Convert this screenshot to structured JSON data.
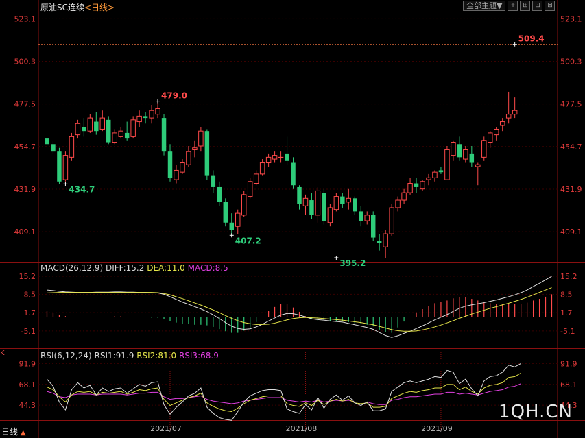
{
  "header": {
    "title": "原油SC连续",
    "period": "<日线>"
  },
  "toolbar": {
    "theme_label": "全部主题▼",
    "buttons": [
      "+",
      "⊞",
      "⊡",
      "⊠"
    ]
  },
  "macd_header": {
    "params": "MACD(26,12,9)",
    "diff": "DIFF:15.2",
    "dea": "DEA:11.0",
    "macd": "MACD:8.5"
  },
  "rsi_header": {
    "params": "RSI(6,12,24)",
    "rsi1": "RSI1:91.9",
    "rsi2": "RSI2:81.0",
    "rsi3": "RSI3:68.9"
  },
  "watermark": "1QH.CN",
  "period_button": {
    "label": "日线",
    "arrow": "▲"
  },
  "side_mark": "K",
  "colors": {
    "up": "#ff4a4a",
    "down": "#2ecc7a",
    "axis": "#e03a3a",
    "grid": "#3a0000",
    "diff": "#e0e0e0",
    "dea": "#e6e64a",
    "rsi3": "#e040e0"
  },
  "chart_data": [
    {
      "type": "candlestick",
      "title": "原油SC连续",
      "y_ticks": [
        409.1,
        431.9,
        454.7,
        477.5,
        500.3,
        523.1
      ],
      "ylim": [
        393.0,
        528.0
      ],
      "x_ticks": [
        {
          "label": "2021/07",
          "index": 20
        },
        {
          "label": "2021/08",
          "index": 42
        },
        {
          "label": "2021/09",
          "index": 64
        }
      ],
      "reference_line": 509.4,
      "annotations": [
        {
          "label": "479.0",
          "index": 18,
          "value": 479.0,
          "pos": "high",
          "color": "up"
        },
        {
          "label": "434.7",
          "index": 3,
          "value": 434.7,
          "pos": "low",
          "color": "down"
        },
        {
          "label": "407.2",
          "index": 30,
          "value": 407.2,
          "pos": "low",
          "color": "down"
        },
        {
          "label": "395.2",
          "index": 47,
          "value": 395.2,
          "pos": "low",
          "color": "down"
        },
        {
          "label": "509.4",
          "index": 76,
          "value": 509.4,
          "pos": "high",
          "color": "up"
        }
      ],
      "ohlc": [
        [
          459,
          463,
          455,
          456
        ],
        [
          456,
          458,
          451,
          452
        ],
        [
          452,
          454,
          434.7,
          436
        ],
        [
          437,
          452,
          436,
          450
        ],
        [
          449,
          462,
          447,
          460
        ],
        [
          461,
          469,
          459,
          467
        ],
        [
          465,
          470,
          460,
          463
        ],
        [
          463,
          472,
          462,
          470
        ],
        [
          468,
          473,
          461,
          463
        ],
        [
          464,
          474,
          463,
          470
        ],
        [
          469,
          471,
          456,
          457
        ],
        [
          457,
          464,
          456,
          462
        ],
        [
          460,
          465,
          459,
          463
        ],
        [
          462,
          468,
          458,
          459
        ],
        [
          460,
          471,
          459,
          469
        ],
        [
          468,
          474,
          465,
          471
        ],
        [
          471,
          473,
          467,
          470
        ],
        [
          470,
          477,
          467,
          474
        ],
        [
          472,
          479.0,
          470,
          475
        ],
        [
          470,
          472,
          450,
          452
        ],
        [
          452,
          456,
          436,
          438
        ],
        [
          437,
          445,
          435,
          442
        ],
        [
          441,
          448,
          440,
          446
        ],
        [
          445,
          455,
          444,
          452
        ],
        [
          453,
          458,
          449,
          454
        ],
        [
          455,
          465,
          452,
          463
        ],
        [
          463,
          464,
          437,
          439
        ],
        [
          439,
          442,
          430,
          433
        ],
        [
          433,
          436,
          423,
          425
        ],
        [
          425,
          427,
          412,
          414
        ],
        [
          414,
          419,
          407.2,
          410
        ],
        [
          412,
          421,
          408,
          419
        ],
        [
          418,
          431,
          417,
          429
        ],
        [
          428,
          438,
          427,
          436
        ],
        [
          435,
          442,
          434,
          440
        ],
        [
          440,
          448,
          439,
          446
        ],
        [
          446,
          451,
          444,
          449
        ],
        [
          448,
          452,
          446,
          450
        ],
        [
          449,
          452,
          446,
          449
        ],
        [
          451,
          460,
          445,
          447
        ],
        [
          446,
          449,
          432,
          434
        ],
        [
          433,
          434,
          421,
          424
        ],
        [
          423,
          429,
          418,
          427
        ],
        [
          426,
          430,
          416,
          418
        ],
        [
          418,
          433,
          414,
          431
        ],
        [
          430,
          432,
          413,
          415
        ],
        [
          414,
          424,
          412,
          422
        ],
        [
          421,
          430,
          420,
          428
        ],
        [
          428,
          430,
          422,
          424
        ],
        [
          425,
          432,
          421,
          427
        ],
        [
          427,
          428,
          418,
          420
        ],
        [
          420,
          423,
          412,
          415
        ],
        [
          415,
          420,
          413,
          418
        ],
        [
          418,
          420,
          404,
          406
        ],
        [
          404,
          408,
          399,
          403
        ],
        [
          401,
          410,
          395.2,
          408
        ],
        [
          408,
          424,
          407,
          422
        ],
        [
          422,
          428,
          420,
          426
        ],
        [
          426,
          432,
          424,
          430
        ],
        [
          430,
          438,
          429,
          435
        ],
        [
          435,
          438,
          430,
          433
        ],
        [
          432,
          437,
          431,
          436
        ],
        [
          437,
          440,
          434,
          438
        ],
        [
          438,
          442,
          436,
          441
        ],
        [
          442,
          444,
          440,
          441
        ],
        [
          437,
          455,
          442,
          453
        ],
        [
          450,
          458,
          447,
          457
        ],
        [
          456,
          460,
          447,
          449
        ],
        [
          448,
          455,
          446,
          453
        ],
        [
          451,
          455,
          444,
          446
        ],
        [
          444,
          446,
          434,
          445
        ],
        [
          449,
          460,
          447,
          458
        ],
        [
          457,
          463,
          454,
          462
        ],
        [
          461,
          465,
          458,
          464
        ],
        [
          466,
          470,
          463,
          468
        ],
        [
          470,
          484,
          467,
          472
        ],
        [
          472,
          481,
          470,
          474
        ]
      ]
    },
    {
      "type": "line+bar",
      "title": "MACD(26,12,9)",
      "y_ticks": [
        -5.1,
        1.7,
        8.5,
        15.2
      ],
      "ylim": [
        -11.5,
        17.5
      ],
      "series": [
        {
          "name": "DIFF",
          "values": [
            10.1,
            9.9,
            9.6,
            9.4,
            9.3,
            9.2,
            9.2,
            9.2,
            9.3,
            9.3,
            9.3,
            9.4,
            9.4,
            9.3,
            9.3,
            9.2,
            9.2,
            9.1,
            9.0,
            8.5,
            7.6,
            6.6,
            5.6,
            4.8,
            3.9,
            3.1,
            2.1,
            0.9,
            -0.5,
            -2.0,
            -3.3,
            -4.2,
            -4.5,
            -4.3,
            -3.6,
            -2.6,
            -1.4,
            -0.3,
            0.8,
            1.4,
            1.3,
            0.8,
            0.1,
            -0.6,
            -0.9,
            -1.1,
            -1.4,
            -1.6,
            -1.8,
            -2.3,
            -2.8,
            -3.3,
            -3.8,
            -4.5,
            -5.7,
            -6.8,
            -7.5,
            -6.9,
            -6.0,
            -5.2,
            -4.2,
            -3.2,
            -2.1,
            -1.0,
            0.0,
            1.0,
            2.2,
            3.3,
            4.1,
            4.6,
            5.0,
            5.4,
            5.9,
            6.4,
            7.0,
            7.6,
            8.3,
            9.1,
            10.1,
            11.4,
            12.6,
            13.9,
            15.2
          ]
        },
        {
          "name": "DEA",
          "values": [
            9.0,
            9.1,
            9.2,
            9.2,
            9.2,
            9.2,
            9.2,
            9.2,
            9.2,
            9.2,
            9.2,
            9.2,
            9.2,
            9.2,
            9.2,
            9.2,
            9.2,
            9.2,
            9.1,
            8.8,
            8.3,
            7.6,
            6.9,
            6.1,
            5.3,
            4.5,
            3.6,
            2.7,
            1.7,
            0.6,
            -0.4,
            -1.3,
            -2.0,
            -2.4,
            -2.7,
            -2.7,
            -2.6,
            -2.2,
            -1.6,
            -1.0,
            -0.5,
            -0.2,
            -0.1,
            -0.2,
            -0.3,
            -0.5,
            -0.7,
            -0.9,
            -1.1,
            -1.4,
            -1.7,
            -2.0,
            -2.4,
            -2.8,
            -3.4,
            -4.0,
            -4.6,
            -5.0,
            -5.2,
            -5.2,
            -5.1,
            -4.7,
            -4.2,
            -3.6,
            -2.9,
            -2.1,
            -1.3,
            -0.4,
            0.4,
            1.2,
            1.9,
            2.6,
            3.3,
            3.9,
            4.6,
            5.2,
            5.9,
            6.6,
            7.4,
            8.3,
            9.2,
            10.1,
            11.0
          ]
        },
        {
          "name": "MACD",
          "values": [
            2.2,
            1.6,
            0.8,
            0.4,
            0.2,
            0.0,
            0.0,
            0.0,
            0.2,
            0.2,
            0.2,
            0.4,
            0.4,
            0.2,
            0.2,
            0.0,
            0.0,
            -0.2,
            -0.2,
            -0.6,
            -1.4,
            -2.0,
            -2.6,
            -2.6,
            -2.8,
            -2.8,
            -3.0,
            -3.6,
            -4.4,
            -5.2,
            -5.8,
            -5.8,
            -5.0,
            -3.8,
            -1.8,
            0.2,
            2.4,
            3.8,
            4.8,
            4.8,
            3.6,
            2.0,
            0.4,
            -0.8,
            -1.2,
            -1.2,
            -1.4,
            -1.4,
            -1.4,
            -1.8,
            -2.2,
            -2.6,
            -2.8,
            -3.4,
            -4.6,
            -5.6,
            -5.8,
            -3.8,
            -1.6,
            0.0,
            1.8,
            3.0,
            4.2,
            5.2,
            5.8,
            6.2,
            7.0,
            7.4,
            7.4,
            6.8,
            6.2,
            5.6,
            5.2,
            5.0,
            4.8,
            4.8,
            4.8,
            5.0,
            5.4,
            6.2,
            6.8,
            7.6,
            8.5
          ]
        }
      ]
    },
    {
      "type": "line",
      "title": "RSI(6,12,24)",
      "y_ticks": [
        44.3,
        68.1,
        91.9
      ],
      "ylim": [
        28.0,
        100.0
      ],
      "series": [
        {
          "name": "RSI1",
          "values": [
            74,
            66,
            48,
            39,
            62,
            70,
            64,
            67,
            56,
            64,
            60,
            63,
            64,
            58,
            63,
            68,
            66,
            70,
            71,
            45,
            34,
            42,
            48,
            55,
            58,
            64,
            42,
            35,
            30,
            28,
            27,
            37,
            48,
            55,
            58,
            61,
            62,
            62,
            61,
            40,
            37,
            35,
            45,
            39,
            53,
            41,
            51,
            56,
            50,
            55,
            47,
            44,
            48,
            38,
            38,
            40,
            60,
            65,
            70,
            72,
            70,
            72,
            74,
            77,
            76,
            84,
            82,
            69,
            74,
            63,
            55,
            72,
            77,
            78,
            82,
            90,
            88,
            91.9
          ]
        },
        {
          "name": "RSI2",
          "values": [
            65,
            62,
            54,
            48,
            56,
            60,
            59,
            60,
            56,
            59,
            58,
            59,
            60,
            57,
            59,
            62,
            61,
            63,
            64,
            51,
            44,
            47,
            50,
            53,
            55,
            58,
            47,
            43,
            40,
            38,
            37,
            41,
            46,
            50,
            52,
            54,
            55,
            55,
            55,
            46,
            44,
            43,
            47,
            44,
            50,
            45,
            49,
            51,
            49,
            51,
            47,
            46,
            47,
            42,
            42,
            43,
            52,
            55,
            58,
            60,
            59,
            61,
            62,
            64,
            64,
            68,
            68,
            62,
            65,
            60,
            57,
            64,
            67,
            68,
            70,
            76,
            77,
            81.0
          ]
        },
        {
          "name": "RSI3",
          "values": [
            60,
            58,
            54,
            53,
            56,
            57,
            57,
            57,
            56,
            57,
            57,
            57,
            57,
            56,
            57,
            58,
            58,
            59,
            59,
            54,
            51,
            52,
            52,
            53,
            54,
            55,
            51,
            49,
            48,
            47,
            46,
            47,
            49,
            50,
            51,
            52,
            53,
            53,
            53,
            50,
            49,
            48,
            49,
            48,
            50,
            48,
            49,
            50,
            49,
            50,
            48,
            48,
            48,
            46,
            45,
            45,
            50,
            51,
            53,
            54,
            54,
            55,
            56,
            57,
            57,
            59,
            59,
            57,
            58,
            57,
            56,
            58,
            60,
            61,
            62,
            65,
            66,
            68.9
          ]
        }
      ]
    }
  ]
}
